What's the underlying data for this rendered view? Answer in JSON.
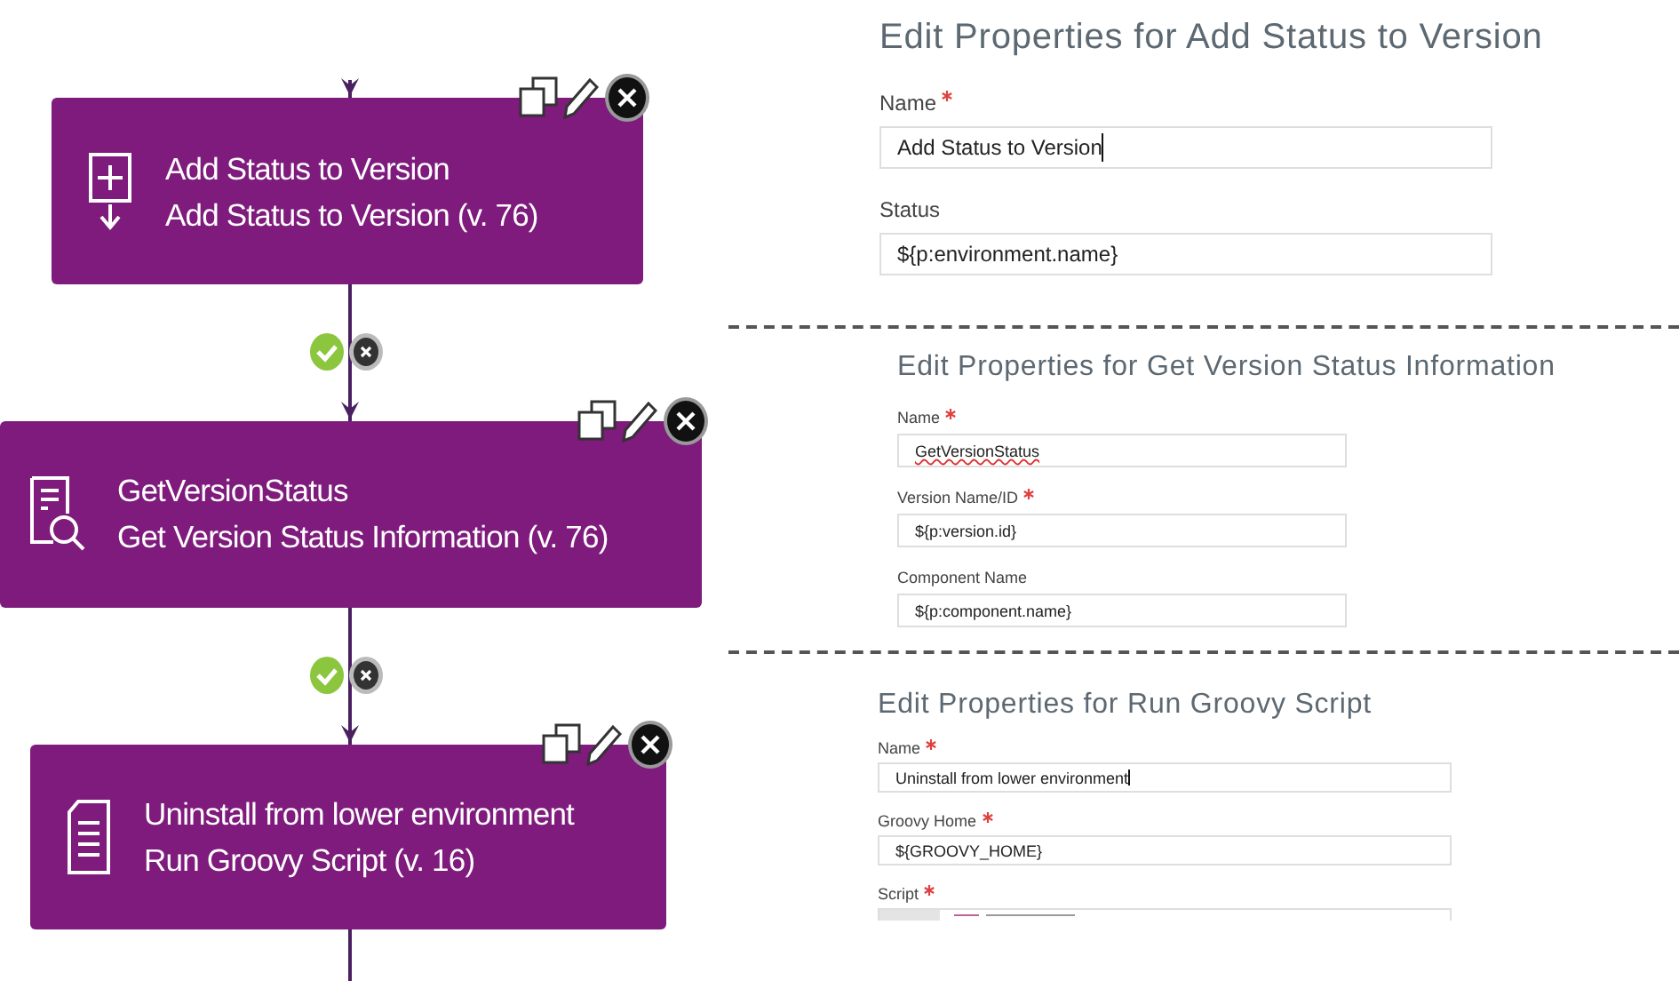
{
  "workflow": {
    "steps": [
      {
        "kind": "add",
        "name": "Add Status to Version",
        "plugin": "Add Status to Version (v. 76)"
      },
      {
        "kind": "inspect",
        "name": "GetVersionStatus",
        "plugin": "Get Version Status Information (v. 76)"
      },
      {
        "kind": "script",
        "name": "Uninstall from lower environment",
        "plugin": "Run Groovy Script (v. 16)"
      }
    ]
  },
  "property_panels": [
    {
      "title": "Edit Properties for Add Status to Version",
      "fields": [
        {
          "kind": "text",
          "label": "Name",
          "required": true,
          "value": "Add Status to Version",
          "focused": true,
          "misspelled": false
        },
        {
          "kind": "text",
          "label": "Status",
          "required": false,
          "value": "${p:environment.name}",
          "focused": false,
          "misspelled": false
        }
      ]
    },
    {
      "title": "Edit Properties for Get Version Status Information",
      "fields": [
        {
          "kind": "text",
          "label": "Name",
          "required": true,
          "value": "GetVersionStatus",
          "focused": false,
          "misspelled": true
        },
        {
          "kind": "text",
          "label": "Version Name/ID",
          "required": true,
          "value": "${p:version.id}",
          "focused": false,
          "misspelled": false
        },
        {
          "kind": "text",
          "label": "Component Name",
          "required": false,
          "value": "${p:component.name}",
          "focused": false,
          "misspelled": false
        }
      ]
    },
    {
      "title": "Edit Properties for Run Groovy Script",
      "fields": [
        {
          "kind": "text",
          "label": "Name",
          "required": true,
          "value": "Uninstall from lower environment",
          "focused": true,
          "misspelled": false
        },
        {
          "kind": "text",
          "label": "Groovy Home",
          "required": true,
          "value": "${GROOVY_HOME}",
          "focused": false,
          "misspelled": false
        },
        {
          "kind": "code",
          "label": "Script",
          "required": true
        }
      ]
    }
  ]
}
